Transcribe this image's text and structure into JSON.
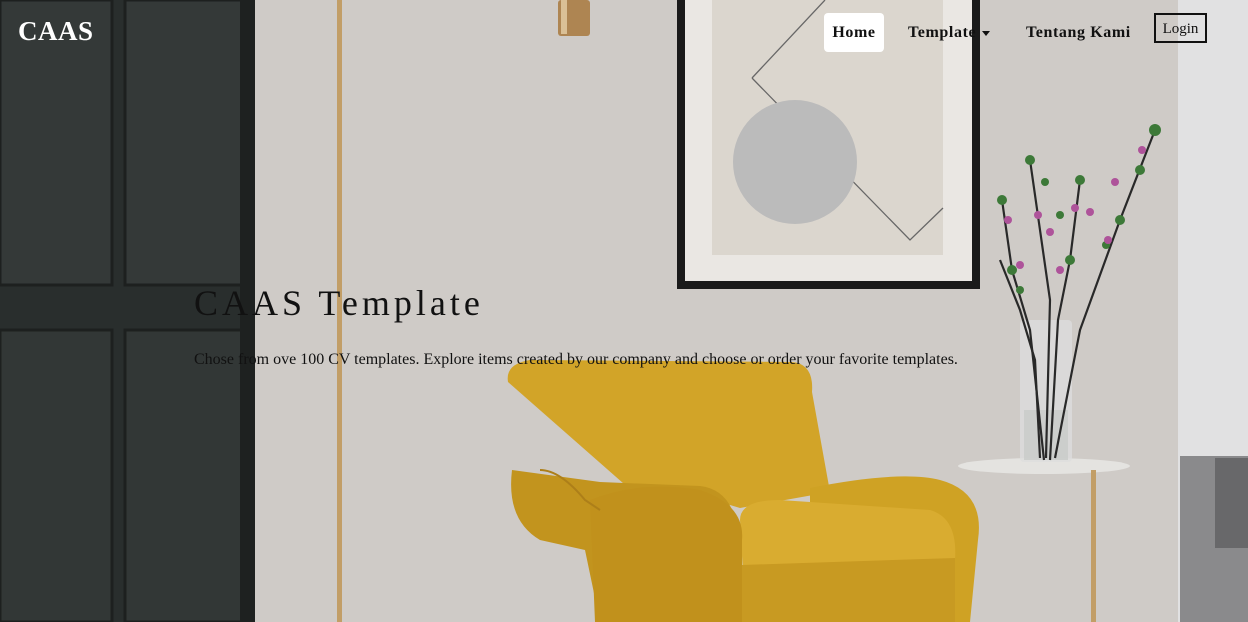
{
  "nav": {
    "brand": "CAAS",
    "items": [
      {
        "label": "Home",
        "active": true
      },
      {
        "label": "Template",
        "dropdown": true
      },
      {
        "label": "Tentang Kami"
      }
    ],
    "login_label": "Login"
  },
  "hero": {
    "title": "CAAS Template",
    "subtitle": "Chose from ove 100 CV templates. Explore items created by our company and choose or order your favorite templates."
  },
  "colors": {
    "accent_chair": "#e2b52e",
    "text": "#111111",
    "nav_active_bg": "#ffffff"
  }
}
